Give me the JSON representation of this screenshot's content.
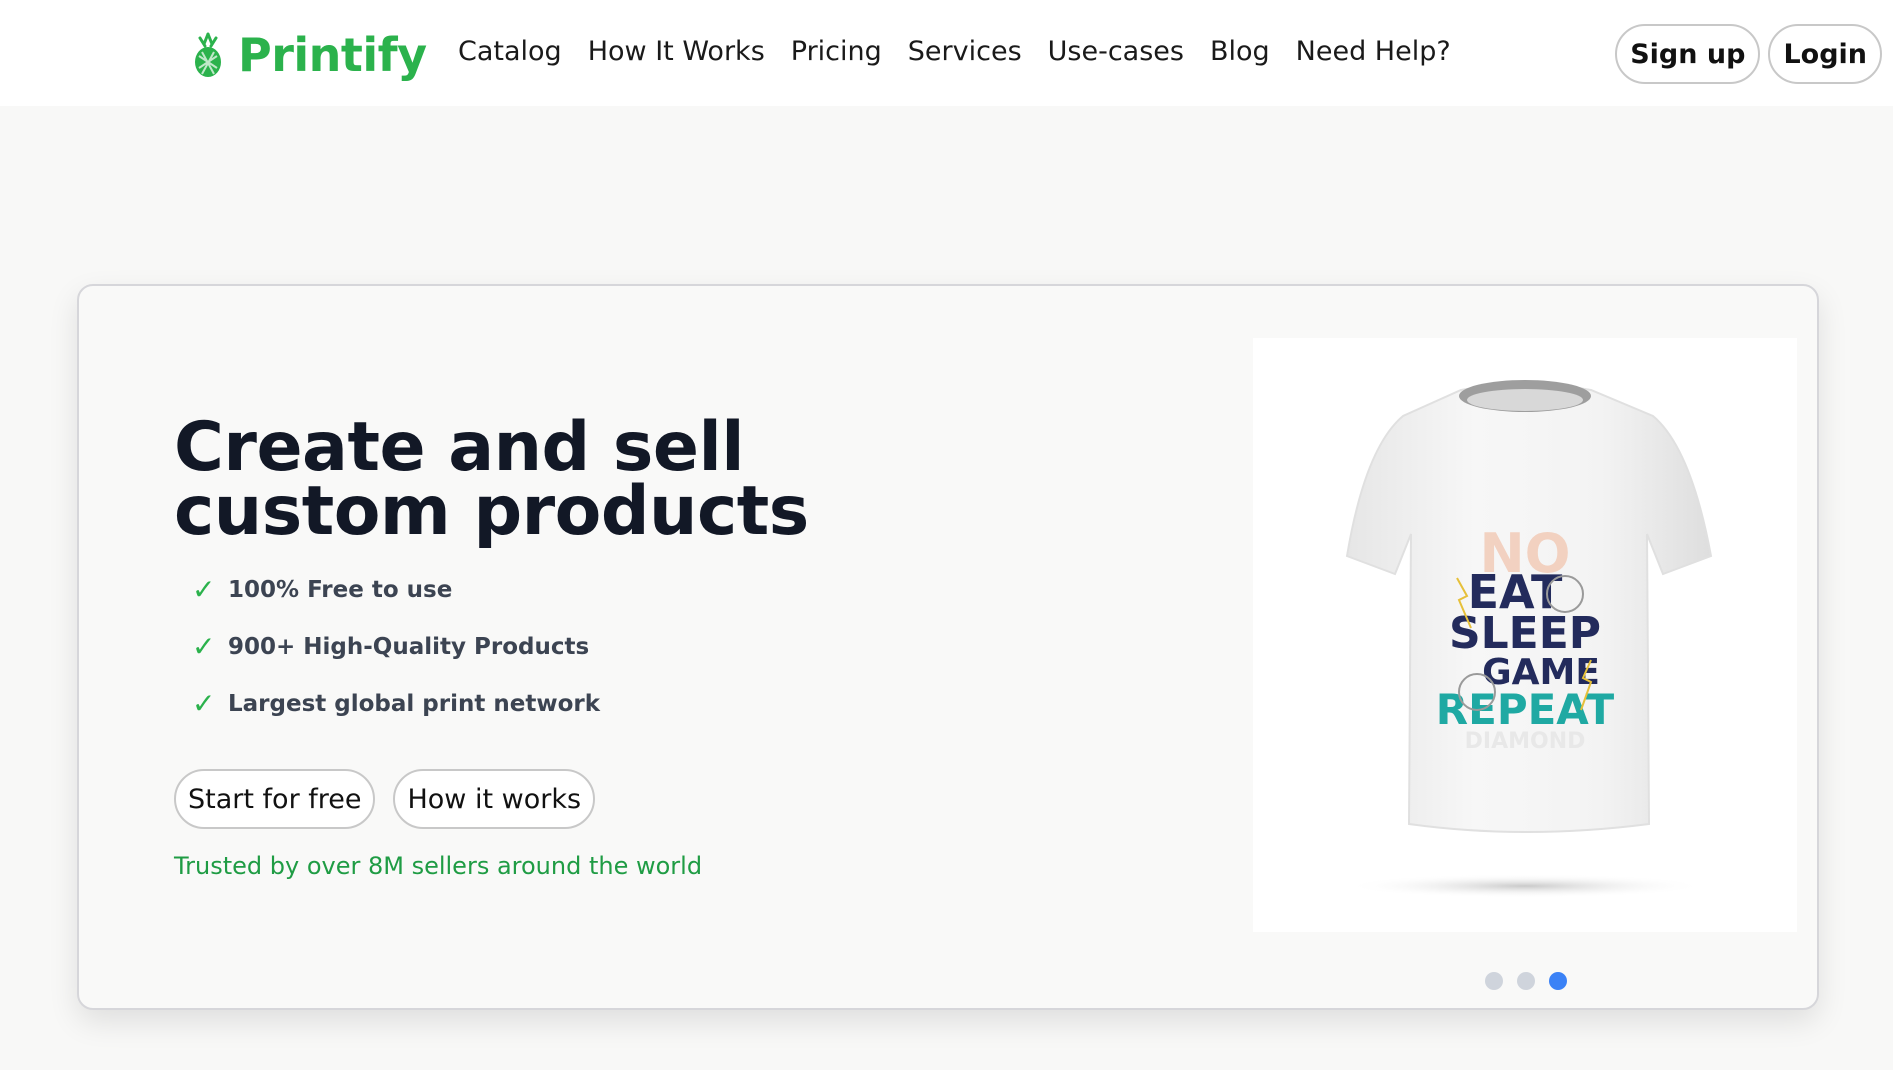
{
  "brand": {
    "name": "Printify",
    "icon": "pineapple-logo-icon",
    "accent": "#2bb24c"
  },
  "nav": {
    "items": [
      {
        "label": "Catalog"
      },
      {
        "label": "How It Works"
      },
      {
        "label": "Pricing"
      },
      {
        "label": "Services"
      },
      {
        "label": "Use-cases"
      },
      {
        "label": "Blog"
      },
      {
        "label": "Need Help?"
      }
    ]
  },
  "auth": {
    "signup_label": "Sign up",
    "login_label": "Login"
  },
  "hero": {
    "title": "Create and sell custom products",
    "features": [
      {
        "icon": "check-icon",
        "text": "100% Free to use"
      },
      {
        "icon": "check-icon",
        "text": "900+ High-Quality Products"
      },
      {
        "icon": "check-icon",
        "text": "Largest global print network"
      }
    ],
    "start_label": "Start for free",
    "how_label": "How it works",
    "trusted_text": "Trusted by over 8M sellers around the world",
    "image": {
      "subject": "white-tshirt",
      "print_lines": [
        "NO",
        "EAT",
        "SLEEP",
        "GAME",
        "REPEAT",
        "DIAMOND"
      ]
    },
    "carousel": {
      "total": 3,
      "active_index": 2,
      "active_color": "#3b82f6"
    }
  }
}
